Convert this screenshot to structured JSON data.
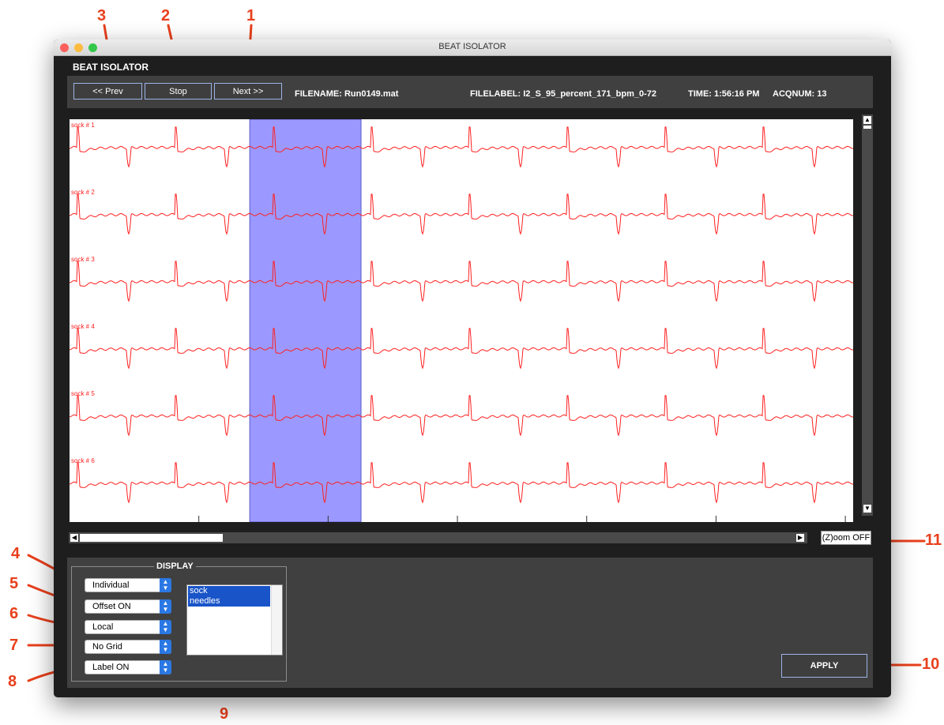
{
  "window": {
    "title": "BEAT ISOLATOR",
    "app_title": "BEAT ISOLATOR",
    "traffic_lights": [
      "#fc605c",
      "#fdbc40",
      "#34c84a"
    ]
  },
  "toolbar": {
    "prev_label": "<< Prev",
    "stop_label": "Stop",
    "next_label": "Next >>",
    "filename": "FILENAME: Run0149.mat",
    "filelabel": "FILELABEL: I2_S_95_percent_171_bpm_0-72",
    "time": "TIME: 1:56:16 PM",
    "acqnum": "ACQNUM: 13"
  },
  "plot": {
    "trace_color": "#ff2020",
    "highlight_color": "#9b99ff",
    "selection_start_fraction": 0.23,
    "selection_end_fraction": 0.372,
    "traces": [
      {
        "label": "sock # 1"
      },
      {
        "label": "sock # 2"
      },
      {
        "label": "sock # 3"
      },
      {
        "label": "sock # 4"
      },
      {
        "label": "sock # 5"
      },
      {
        "label": "sock # 6"
      }
    ]
  },
  "scrollbars": {
    "up_icon": "▲",
    "down_icon": "▼",
    "left_icon": "◀",
    "right_icon": "▶",
    "horizontal_thumb_fraction": 0.2
  },
  "zoom_button": "(Z)oom OFF",
  "display": {
    "title": "DISPLAY",
    "popups": [
      {
        "value": "Individual"
      },
      {
        "value": "Offset ON"
      },
      {
        "value": "Local"
      },
      {
        "value": "No Grid"
      },
      {
        "value": "Label ON"
      }
    ],
    "list_items": [
      "sock",
      "needles"
    ]
  },
  "apply_label": "APPLY",
  "callouts": [
    "1",
    "2",
    "3",
    "4",
    "5",
    "6",
    "7",
    "8",
    "9",
    "10",
    "11"
  ],
  "callout_color": "#e8401c"
}
